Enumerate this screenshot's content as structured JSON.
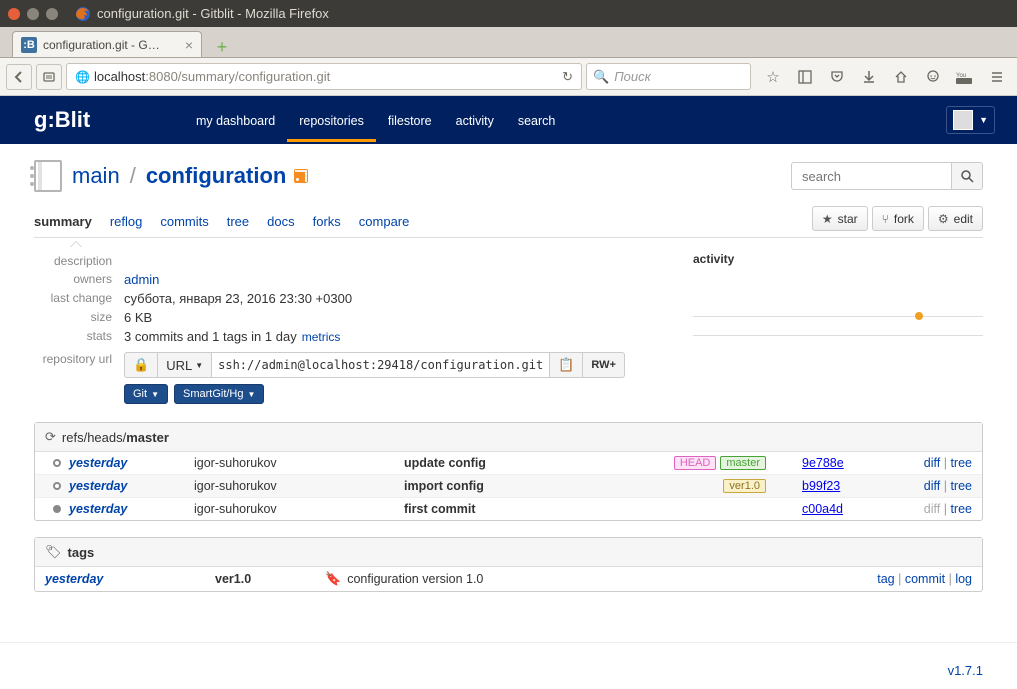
{
  "window": {
    "title": "configuration.git - Gitblit - Mozilla Firefox",
    "tab_title": "configuration.git - G…",
    "url_host": "localhost",
    "url_port_path": ":8080/summary/configuration.git",
    "search_placeholder": "Поиск"
  },
  "header": {
    "nav": [
      "my dashboard",
      "repositories",
      "filestore",
      "activity",
      "search"
    ],
    "active_nav_index": 1
  },
  "repo": {
    "project": "main",
    "slash": "/",
    "name": "configuration",
    "search_placeholder": "search",
    "tabs": [
      "summary",
      "reflog",
      "commits",
      "tree",
      "docs",
      "forks",
      "compare"
    ],
    "active_tab_index": 0,
    "actions": {
      "star": "star",
      "fork": "fork",
      "edit": "edit"
    }
  },
  "meta": {
    "labels": {
      "description": "description",
      "owners": "owners",
      "last_change": "last change",
      "size": "size",
      "stats": "stats",
      "repo_url": "repository url"
    },
    "owners": "admin",
    "last_change": "суббота, января 23, 2016 23:30 +0300",
    "size": "6 KB",
    "stats": "3 commits and 1 tags in 1 day",
    "metrics_label": "metrics",
    "url_label": "URL",
    "url_value": "ssh://admin@localhost:29418/configuration.git",
    "permission": "RW+",
    "clone_git": "Git",
    "clone_smartgit": "SmartGit/Hg"
  },
  "activity": {
    "label": "activity"
  },
  "commits": {
    "header_prefix": "refs/heads/",
    "header_branch": "master",
    "rows": [
      {
        "date": "yesterday",
        "author": "igor-suhorukov",
        "msg": "update config",
        "refs": [
          {
            "t": "head",
            "l": "HEAD"
          },
          {
            "t": "branch",
            "l": "master"
          }
        ],
        "hash": "9e788e",
        "links": {
          "diff": true,
          "tree": true
        }
      },
      {
        "date": "yesterday",
        "author": "igor-suhorukov",
        "msg": "import config",
        "refs": [
          {
            "t": "tag",
            "l": "ver1.0"
          }
        ],
        "hash": "b99f23",
        "links": {
          "diff": true,
          "tree": true
        }
      },
      {
        "date": "yesterday",
        "author": "igor-suhorukov",
        "msg": "first commit",
        "refs": [],
        "hash": "c00a4d",
        "links": {
          "diff": false,
          "tree": true
        }
      }
    ]
  },
  "commit_link_labels": {
    "diff": "diff",
    "tree": "tree",
    "sep": " | "
  },
  "tags": {
    "header": "tags",
    "rows": [
      {
        "date": "yesterday",
        "name": "ver1.0",
        "msg": "configuration version 1.0"
      }
    ],
    "link_labels": {
      "tag": "tag",
      "commit": "commit",
      "log": "log",
      "sep": " | "
    }
  },
  "footer": {
    "version": "v1.7.1"
  }
}
